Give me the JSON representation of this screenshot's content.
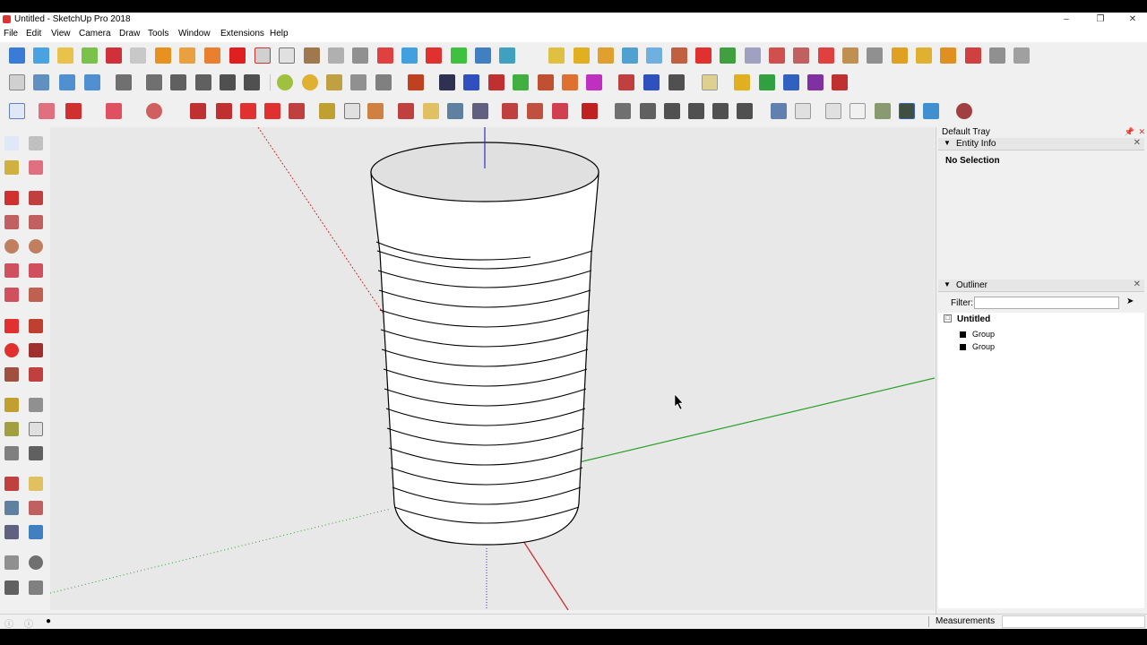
{
  "window": {
    "title": "Untitled - SketchUp Pro 2018",
    "controls": [
      "minimize",
      "maximize",
      "close"
    ]
  },
  "menu": [
    "File",
    "Edit",
    "View",
    "Camera",
    "Draw",
    "Tools",
    "Window",
    "Extensions",
    "Help"
  ],
  "tray": {
    "title": "Default Tray",
    "entity_info": {
      "header": "Entity Info",
      "selection": "No Selection"
    },
    "outliner": {
      "header": "Outliner",
      "filter_label": "Filter:",
      "filter_value": "",
      "root": "Untitled",
      "items": [
        "Group",
        "Group"
      ]
    }
  },
  "status": {
    "measurements_label": "Measurements",
    "measurements_value": ""
  },
  "colors": {
    "red_axis": "#d03030",
    "green_axis": "#2aa02a",
    "blue_axis": "#3030c0",
    "viewport_bg": "#e8e8e8"
  }
}
